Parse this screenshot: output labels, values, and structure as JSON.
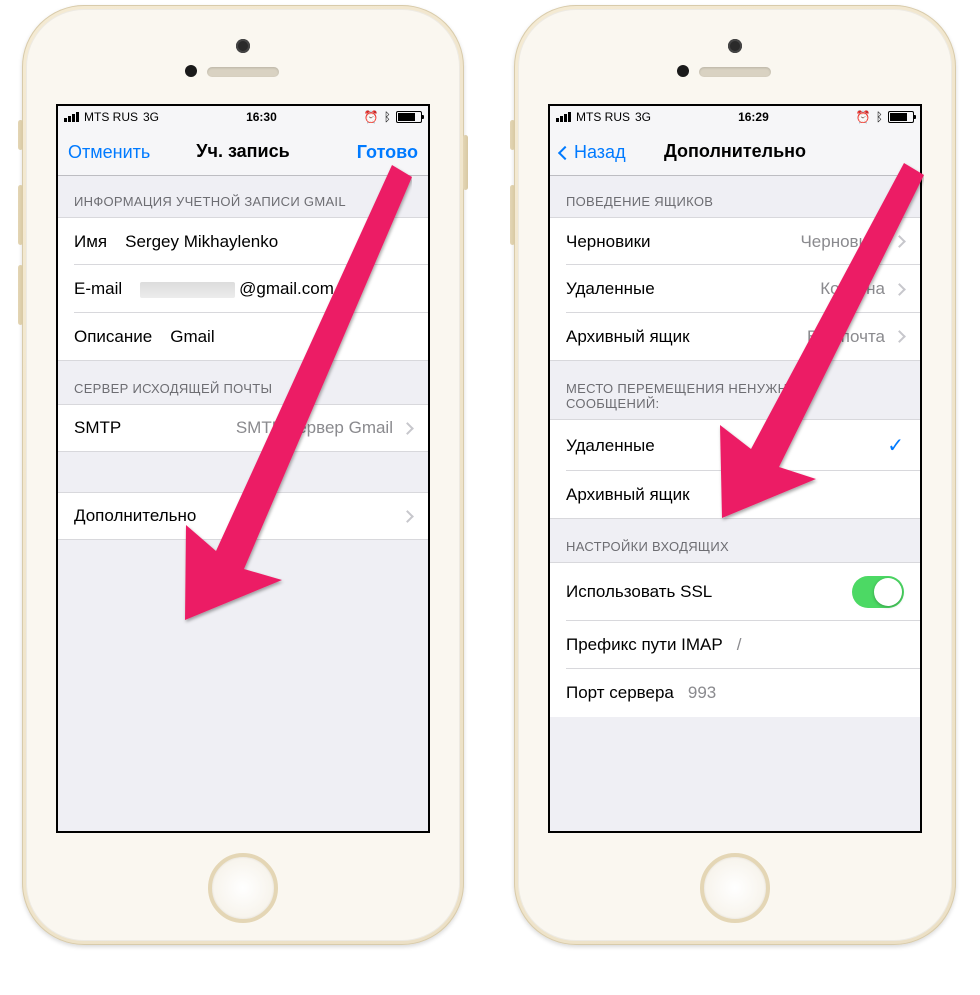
{
  "left": {
    "status": {
      "carrier": "MTS RUS",
      "net": "3G",
      "time": "16:30"
    },
    "nav": {
      "cancel": "Отменить",
      "title": "Уч. запись",
      "done": "Готово"
    },
    "sec1_header": "ИНФОРМАЦИЯ УЧЕТНОЙ ЗАПИСИ GMAIL",
    "name_lbl": "Имя",
    "name_val": "Sergey Mikhaylenko",
    "email_lbl": "E-mail",
    "email_val": "@gmail.com",
    "desc_lbl": "Описание",
    "desc_val": "Gmail",
    "sec2_header": "СЕРВЕР ИСХОДЯЩЕЙ ПОЧТЫ",
    "smtp_lbl": "SMTP",
    "smtp_val": "SMTP-сервер Gmail",
    "advanced": "Дополнительно"
  },
  "right": {
    "status": {
      "carrier": "MTS RUS",
      "net": "3G",
      "time": "16:29"
    },
    "nav": {
      "back": "Назад",
      "title": "Дополнительно"
    },
    "sec1_header": "ПОВЕДЕНИЕ ЯЩИКОВ",
    "drafts_lbl": "Черновики",
    "drafts_val": "Черновики",
    "deleted_lbl": "Удаленные",
    "deleted_val": "Корзина",
    "archive_lbl": "Архивный ящик",
    "archive_val": "Вся почта",
    "sec2_header": "МЕСТО ПЕРЕМЕЩЕНИЯ НЕНУЖНЫХ СООБЩЕНИЙ:",
    "opt_deleted": "Удаленные",
    "opt_archive": "Архивный ящик",
    "sec3_header": "НАСТРОЙКИ ВХОДЯЩИХ",
    "ssl_lbl": "Использовать SSL",
    "imap_lbl": "Префикс пути IMAP",
    "imap_val": "/",
    "port_lbl": "Порт сервера",
    "port_val": "993"
  }
}
